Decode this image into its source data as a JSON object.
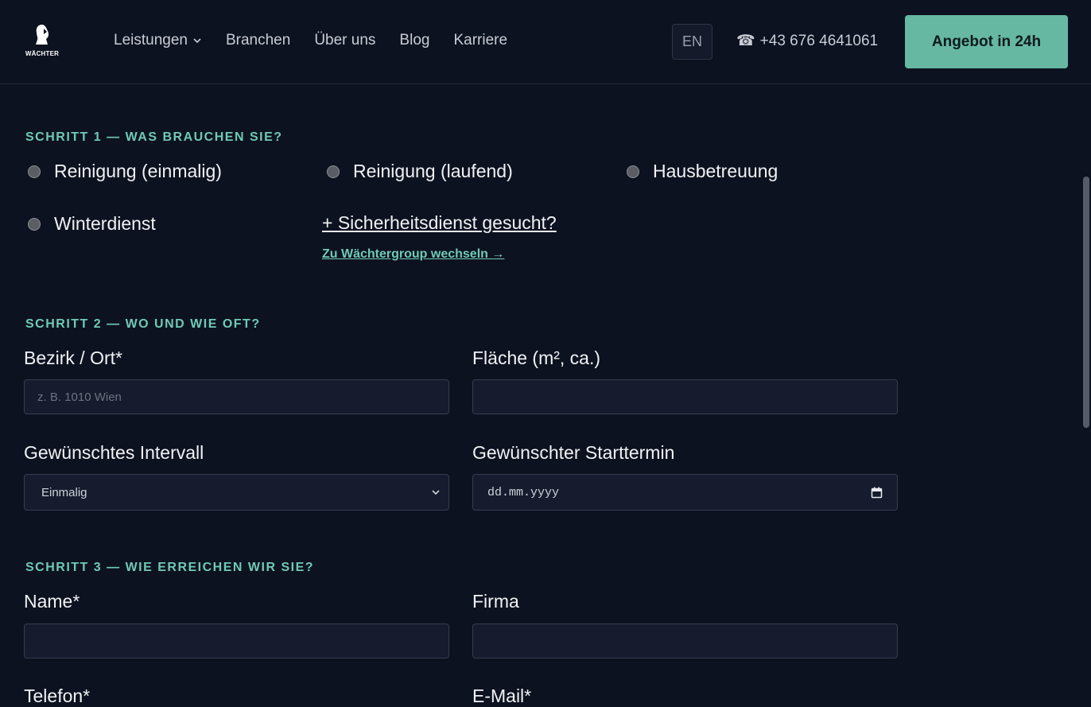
{
  "header": {
    "logo_text": "WÄCHTER",
    "nav": [
      {
        "label": "Leistungen",
        "has_dropdown": true
      },
      {
        "label": "Branchen"
      },
      {
        "label": "Über uns"
      },
      {
        "label": "Blog"
      },
      {
        "label": "Karriere"
      }
    ],
    "lang": "EN",
    "phone_icon": "☎",
    "phone": "+43 676 4641061",
    "cta": "Angebot in 24h"
  },
  "step1": {
    "title": "Schritt 1 — Was brauchen Sie?",
    "options": [
      "Reinigung (einmalig)",
      "Reinigung (laufend)",
      "Hausbetreuung",
      "Winterdienst"
    ],
    "security_link": "+ Sicherheitsdienst gesucht?",
    "switch_link": "Zu Wächtergroup wechseln →"
  },
  "step2": {
    "title": "Schritt 2 — Wo und wie oft?",
    "location_label": "Bezirk / Ort*",
    "location_placeholder": "z. B. 1010 Wien",
    "area_label": "Fläche (m², ca.)",
    "interval_label": "Gewünschtes Intervall",
    "interval_value": "Einmalig",
    "start_label": "Gewünschter Starttermin",
    "start_placeholder": "dd.mm.yyyy"
  },
  "step3": {
    "title": "Schritt 3 — Wie erreichen wir Sie?",
    "name_label": "Name*",
    "company_label": "Firma",
    "phone_label": "Telefon*",
    "email_label": "E-Mail*"
  },
  "colors": {
    "background": "#0d1220",
    "accent": "#66b8a2",
    "accent_text": "#6fcab4",
    "field_bg": "#161c2e"
  }
}
